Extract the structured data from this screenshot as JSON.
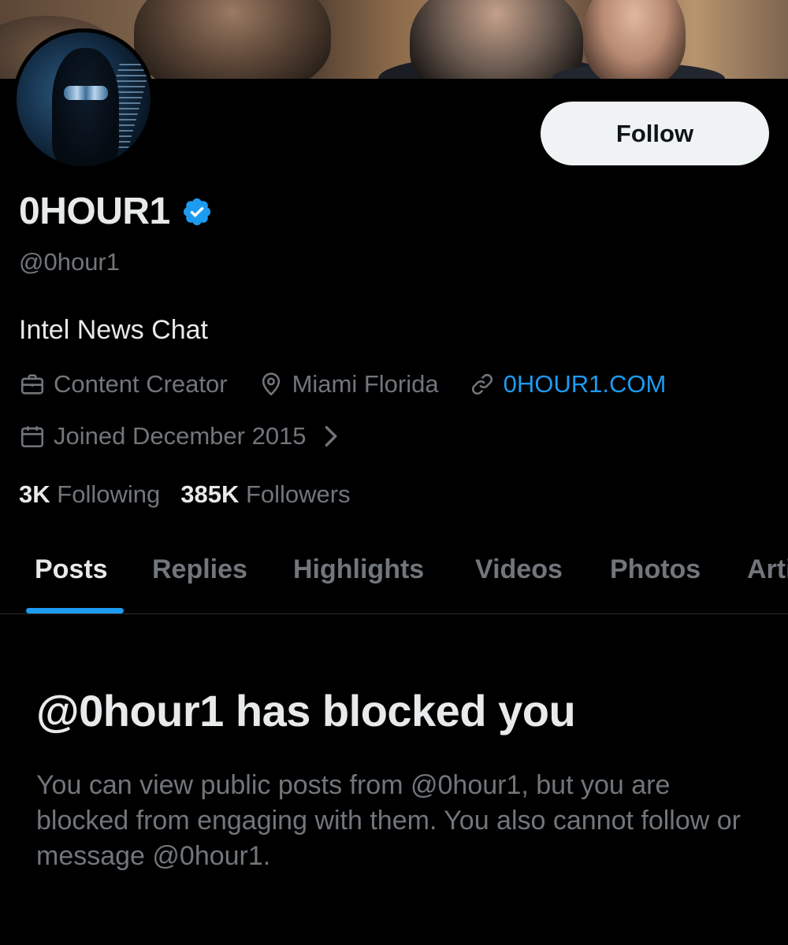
{
  "profile": {
    "display_name": "0HOUR1",
    "handle": "@0hour1",
    "bio": "Intel News Chat",
    "follow_label": "Follow"
  },
  "meta": {
    "category": "Content Creator",
    "location": "Miami Florida",
    "website": "0HOUR1.COM",
    "joined": "Joined December 2015"
  },
  "stats": {
    "following_count": "3K",
    "following_label": "Following",
    "followers_count": "385K",
    "followers_label": "Followers"
  },
  "tabs": [
    {
      "label": "Posts"
    },
    {
      "label": "Replies"
    },
    {
      "label": "Highlights"
    },
    {
      "label": "Videos"
    },
    {
      "label": "Photos"
    },
    {
      "label": "Articles"
    }
  ],
  "blocked": {
    "title": "@0hour1 has blocked you",
    "description": "You can view public posts from @0hour1, but you are blocked from engaging with them. You also cannot follow or message @0hour1."
  },
  "colors": {
    "background": "#000000",
    "accent": "#1d9bf0",
    "secondary_text": "#71767b",
    "verified": "#1d9bf0"
  }
}
